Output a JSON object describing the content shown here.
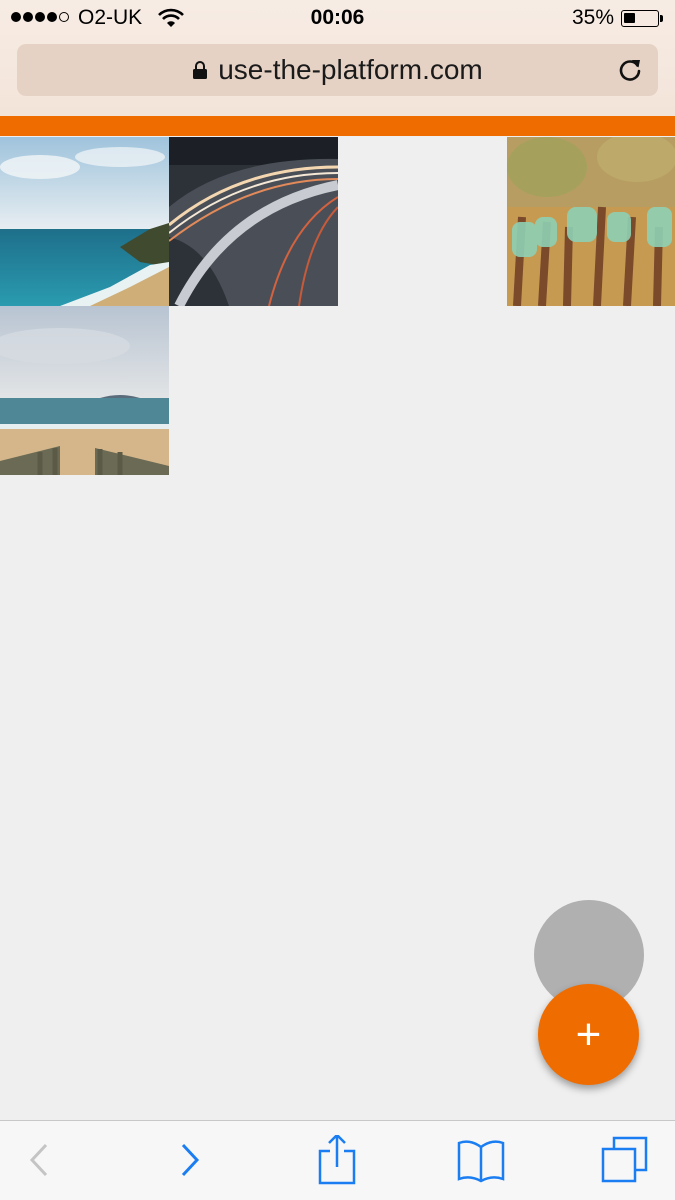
{
  "status_bar": {
    "carrier": "O2-UK",
    "time": "00:06",
    "battery_percent": "35%",
    "battery_level": 0.35,
    "signal_bars_filled": 4,
    "signal_bars_total": 5
  },
  "address_bar": {
    "url": "use-the-platform.com",
    "secure": true
  },
  "theme": {
    "accent": "#ef6c00",
    "background": "#efefef",
    "toolbar_icon": "#1a7ef2",
    "toolbar_icon_disabled": "#c4c4c4"
  },
  "photos": [
    {
      "subject": "coastline-sea",
      "row": 1,
      "col": 1
    },
    {
      "subject": "night-road-light-trails",
      "row": 1,
      "col": 2
    },
    {
      "subject": "glass-bottles-on-fence",
      "row": 1,
      "col": 4
    },
    {
      "subject": "beach-with-stairs",
      "row": 2,
      "col": 1
    }
  ],
  "fab": {
    "label": "+",
    "icon": "plus-icon"
  },
  "toolbar": {
    "buttons": [
      {
        "name": "back",
        "icon": "chevron-left-icon",
        "enabled": false
      },
      {
        "name": "forward",
        "icon": "chevron-right-icon",
        "enabled": true
      },
      {
        "name": "share",
        "icon": "share-icon",
        "enabled": true
      },
      {
        "name": "bookmarks",
        "icon": "book-icon",
        "enabled": true
      },
      {
        "name": "tabs",
        "icon": "tabs-icon",
        "enabled": true
      }
    ]
  }
}
